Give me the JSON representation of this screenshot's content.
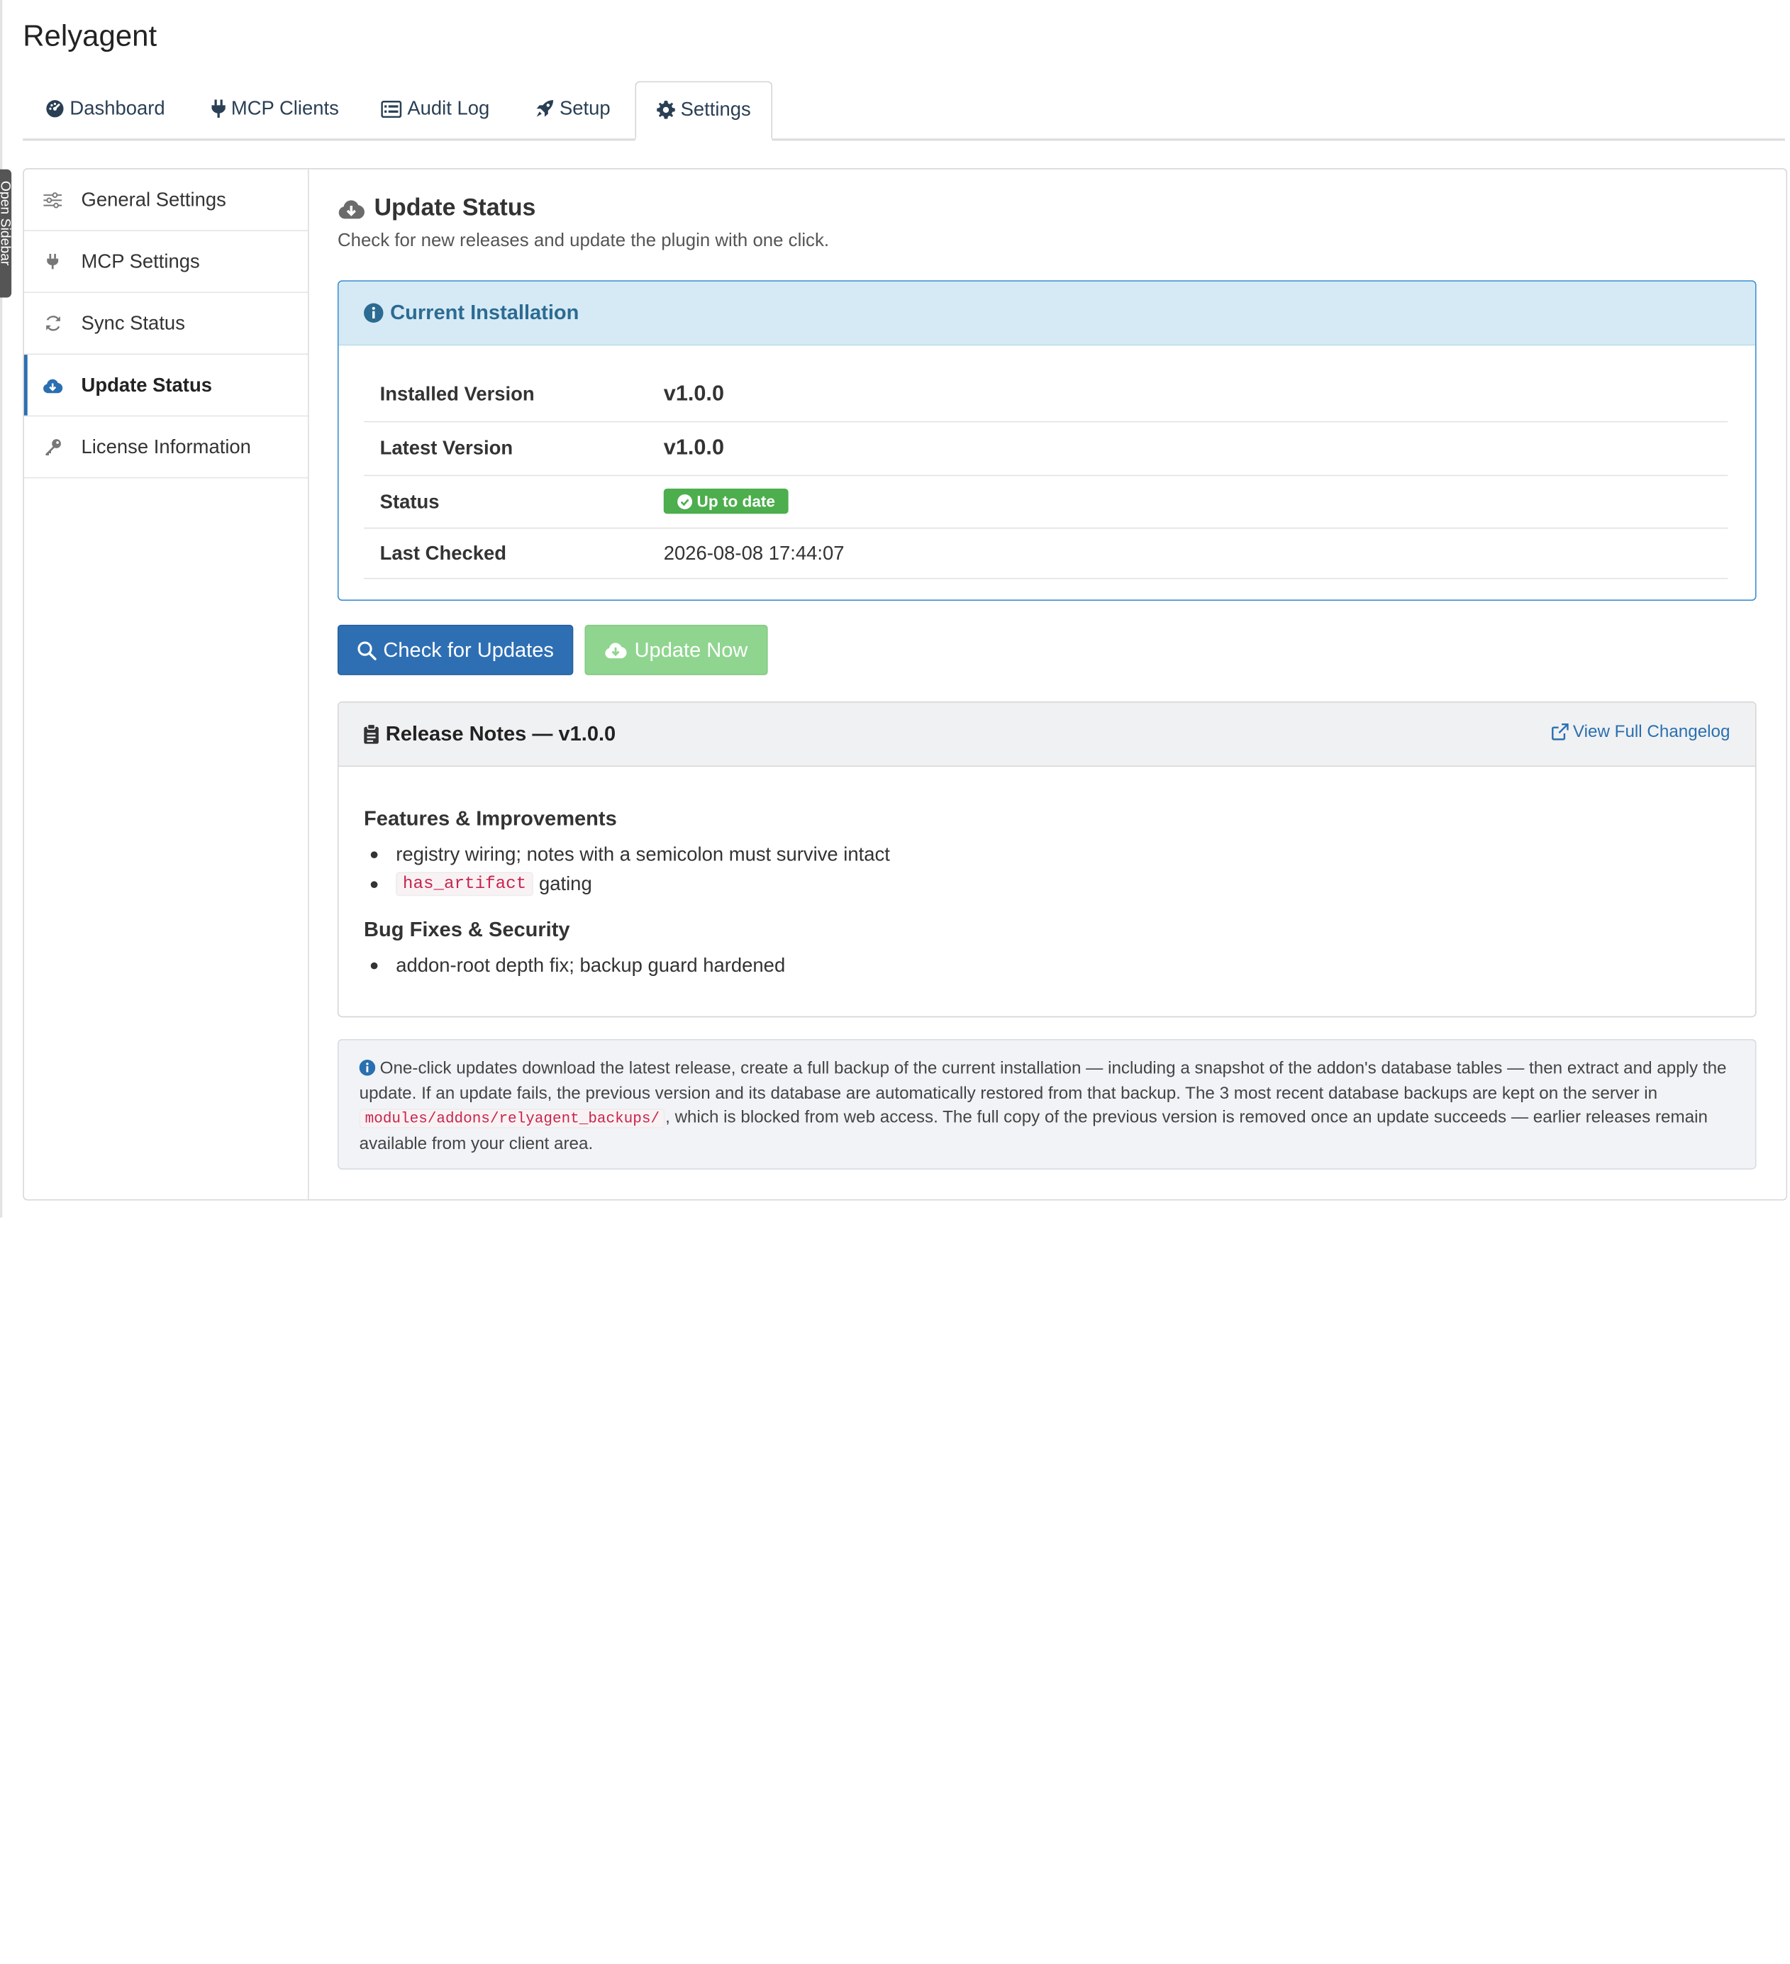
{
  "app": {
    "title": "Relyagent",
    "sidebar_toggle_label": "Open Sidebar"
  },
  "tabs": [
    {
      "label": "Dashboard",
      "icon": "dashboard-icon",
      "active": false
    },
    {
      "label": "MCP Clients",
      "icon": "plug-icon",
      "active": false
    },
    {
      "label": "Audit Log",
      "icon": "list-icon",
      "active": false
    },
    {
      "label": "Setup",
      "icon": "rocket-icon",
      "active": false
    },
    {
      "label": "Settings",
      "icon": "gear-icon",
      "active": true
    }
  ],
  "sidebar": {
    "items": [
      {
        "label": "General Settings",
        "icon": "sliders-icon",
        "active": false
      },
      {
        "label": "MCP Settings",
        "icon": "plug-icon",
        "active": false
      },
      {
        "label": "Sync Status",
        "icon": "sync-icon",
        "active": false
      },
      {
        "label": "Update Status",
        "icon": "cloud-download-icon",
        "active": true
      },
      {
        "label": "License Information",
        "icon": "key-icon",
        "active": false
      }
    ]
  },
  "main": {
    "title": "Update Status",
    "subtitle": "Check for new releases and update the plugin with one click.",
    "installation": {
      "header": "Current Installation",
      "rows": [
        {
          "key": "Installed Version",
          "value": "v1.0.0"
        },
        {
          "key": "Latest Version",
          "value": "v1.0.0"
        },
        {
          "key": "Status",
          "value": "Up to date"
        },
        {
          "key": "Last Checked",
          "value": "2026-08-08 17:44:07"
        }
      ]
    },
    "buttons": {
      "check": "Check for Updates",
      "update": "Update Now"
    },
    "release_notes": {
      "title": "Release Notes — v1.0.0",
      "changelog_link": "View Full Changelog",
      "features_heading": "Features & Improvements",
      "features": [
        {
          "text": "registry wiring; notes with a semicolon must survive intact"
        },
        {
          "code": "has_artifact",
          "text": "gating"
        }
      ],
      "bugfix_heading": "Bug Fixes & Security",
      "bugfixes": [
        {
          "text": "addon-root depth fix; backup guard hardened"
        }
      ]
    },
    "note": {
      "before": "One-click updates download the latest release, create a full backup of the current installation — including a snapshot of the addon's database tables — then extract and apply the update. If an update fails, the previous version and its database are automatically restored from that backup. The 3 most recent database backups are kept on the server in",
      "code": "modules/addons/relyagent_backups/",
      "after": ", which is blocked from web access. The full copy of the previous version is removed once an update succeeds — earlier releases remain available from your client area."
    }
  },
  "colors": {
    "primary": "#2e6fb4",
    "success": "#4cae4c",
    "info_bg": "#d6eaf5",
    "info_text": "#2c6b92"
  }
}
